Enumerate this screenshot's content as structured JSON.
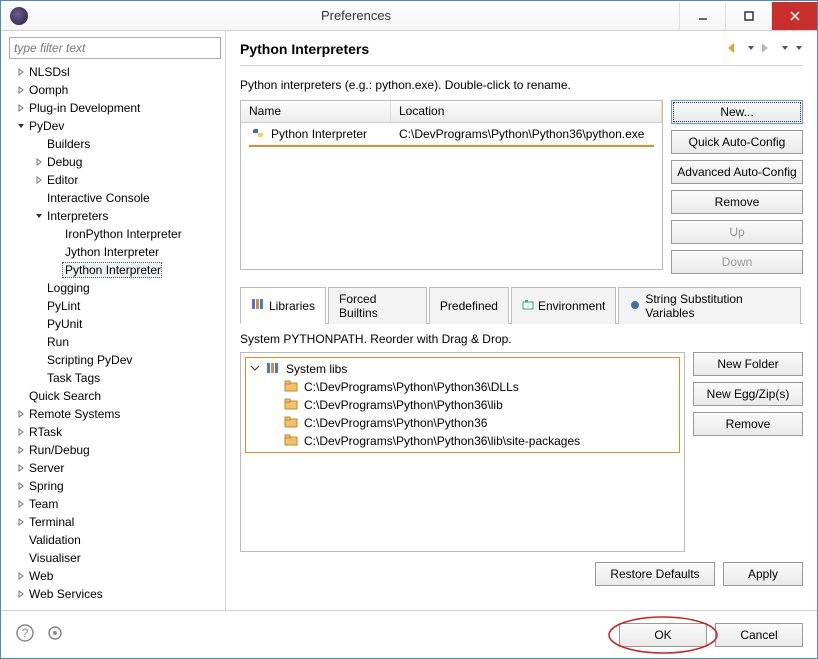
{
  "window": {
    "title": "Preferences"
  },
  "filter": {
    "placeholder": "type filter text"
  },
  "tree": {
    "items": [
      {
        "label": "NLSDsl",
        "level": 1,
        "arrow": "right"
      },
      {
        "label": "Oomph",
        "level": 1,
        "arrow": "right"
      },
      {
        "label": "Plug-in Development",
        "level": 1,
        "arrow": "right"
      },
      {
        "label": "PyDev",
        "level": 1,
        "arrow": "down"
      },
      {
        "label": "Builders",
        "level": 2,
        "arrow": ""
      },
      {
        "label": "Debug",
        "level": 2,
        "arrow": "right"
      },
      {
        "label": "Editor",
        "level": 2,
        "arrow": "right"
      },
      {
        "label": "Interactive Console",
        "level": 2,
        "arrow": ""
      },
      {
        "label": "Interpreters",
        "level": 2,
        "arrow": "down"
      },
      {
        "label": "IronPython Interpreter",
        "level": 3,
        "arrow": ""
      },
      {
        "label": "Jython Interpreter",
        "level": 3,
        "arrow": ""
      },
      {
        "label": "Python Interpreter",
        "level": 3,
        "arrow": "",
        "selected": true
      },
      {
        "label": "Logging",
        "level": 2,
        "arrow": ""
      },
      {
        "label": "PyLint",
        "level": 2,
        "arrow": ""
      },
      {
        "label": "PyUnit",
        "level": 2,
        "arrow": ""
      },
      {
        "label": "Run",
        "level": 2,
        "arrow": ""
      },
      {
        "label": "Scripting PyDev",
        "level": 2,
        "arrow": ""
      },
      {
        "label": "Task Tags",
        "level": 2,
        "arrow": ""
      },
      {
        "label": "Quick Search",
        "level": 1,
        "arrow": ""
      },
      {
        "label": "Remote Systems",
        "level": 1,
        "arrow": "right"
      },
      {
        "label": "RTask",
        "level": 1,
        "arrow": "right"
      },
      {
        "label": "Run/Debug",
        "level": 1,
        "arrow": "right"
      },
      {
        "label": "Server",
        "level": 1,
        "arrow": "right"
      },
      {
        "label": "Spring",
        "level": 1,
        "arrow": "right"
      },
      {
        "label": "Team",
        "level": 1,
        "arrow": "right"
      },
      {
        "label": "Terminal",
        "level": 1,
        "arrow": "right"
      },
      {
        "label": "Validation",
        "level": 1,
        "arrow": ""
      },
      {
        "label": "Visualiser",
        "level": 1,
        "arrow": ""
      },
      {
        "label": "Web",
        "level": 1,
        "arrow": "right"
      },
      {
        "label": "Web Services",
        "level": 1,
        "arrow": "right"
      }
    ]
  },
  "page": {
    "title": "Python Interpreters",
    "subtitle": "Python interpreters (e.g.: python.exe).   Double-click to rename."
  },
  "interp_table": {
    "headers": {
      "name": "Name",
      "location": "Location"
    },
    "rows": [
      {
        "name": "Python Interpreter",
        "location": "C:\\DevPrograms\\Python\\Python36\\python.exe"
      }
    ]
  },
  "right_buttons": {
    "new": "New...",
    "quick": "Quick Auto-Config",
    "advanced": "Advanced Auto-Config",
    "remove": "Remove",
    "up": "Up",
    "down": "Down"
  },
  "tabs": {
    "libraries": "Libraries",
    "forced": "Forced Builtins",
    "predefined": "Predefined",
    "environment": "Environment",
    "stringsub": "String Substitution Variables"
  },
  "syspath_label": "System PYTHONPATH.   Reorder with Drag & Drop.",
  "libs": {
    "root": "System libs",
    "items": [
      "C:\\DevPrograms\\Python\\Python36\\DLLs",
      "C:\\DevPrograms\\Python\\Python36\\lib",
      "C:\\DevPrograms\\Python\\Python36",
      "C:\\DevPrograms\\Python\\Python36\\lib\\site-packages"
    ]
  },
  "libs_buttons": {
    "newfolder": "New Folder",
    "newegg": "New Egg/Zip(s)",
    "remove": "Remove"
  },
  "footer": {
    "restore": "Restore Defaults",
    "apply": "Apply"
  },
  "bottom": {
    "ok": "OK",
    "cancel": "Cancel"
  }
}
